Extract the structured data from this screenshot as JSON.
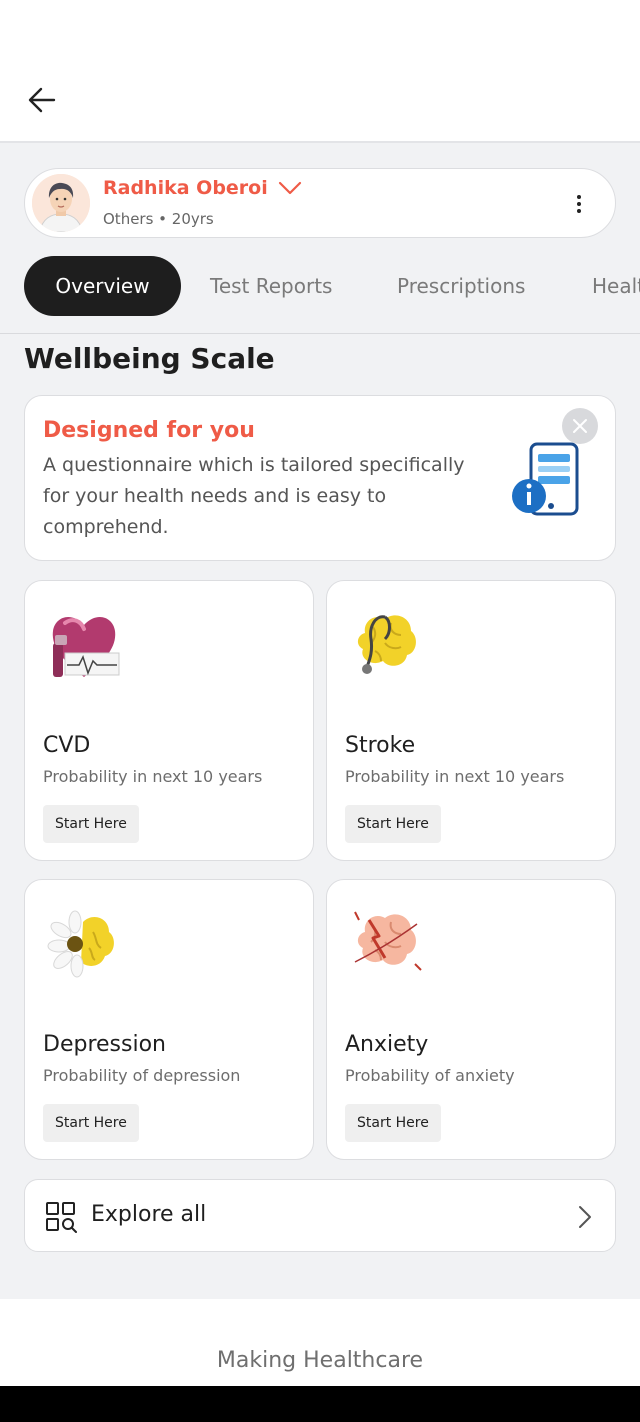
{
  "colors": {
    "accent": "#ef5b47",
    "tab_active_bg": "#1e1e1e",
    "page_bg": "#f1f2f4",
    "card_bg": "#ffffff"
  },
  "header": {
    "back_icon": "arrow-left-icon"
  },
  "profile": {
    "name": "Radhika Oberoi",
    "meta": "Others • 20yrs",
    "avatar_icon": "avatar-icon",
    "dropdown_icon": "chevron-down-icon",
    "menu_icon": "kebab-menu-icon"
  },
  "tabs": [
    {
      "label": "Overview",
      "active": true
    },
    {
      "label": "Test Reports",
      "active": false
    },
    {
      "label": "Prescriptions",
      "active": false
    },
    {
      "label": "Healt",
      "active": false
    }
  ],
  "section": {
    "title": "Wellbeing Scale"
  },
  "promo": {
    "title": "Designed for you",
    "description": "A questionnaire which is tailored specifically for your health needs and is easy to comprehend.",
    "close_icon": "close-icon",
    "illustration": "phone-info-icon"
  },
  "cards": [
    {
      "title": "CVD",
      "subtitle": "Probability in next 10 years",
      "button": "Start Here",
      "icon": "heart-ecg-icon"
    },
    {
      "title": "Stroke",
      "subtitle": "Probability in next 10 years",
      "button": "Start Here",
      "icon": "brain-stethoscope-icon"
    },
    {
      "title": "Depression",
      "subtitle": "Probability of depression",
      "button": "Start Here",
      "icon": "brain-flower-icon"
    },
    {
      "title": "Anxiety",
      "subtitle": "Probability of anxiety",
      "button": "Start Here",
      "icon": "brain-lightning-icon"
    }
  ],
  "explore": {
    "label": "Explore all",
    "icon": "grid-search-icon",
    "chevron": "chevron-right-icon"
  },
  "footer": {
    "text": "Making Healthcare"
  }
}
